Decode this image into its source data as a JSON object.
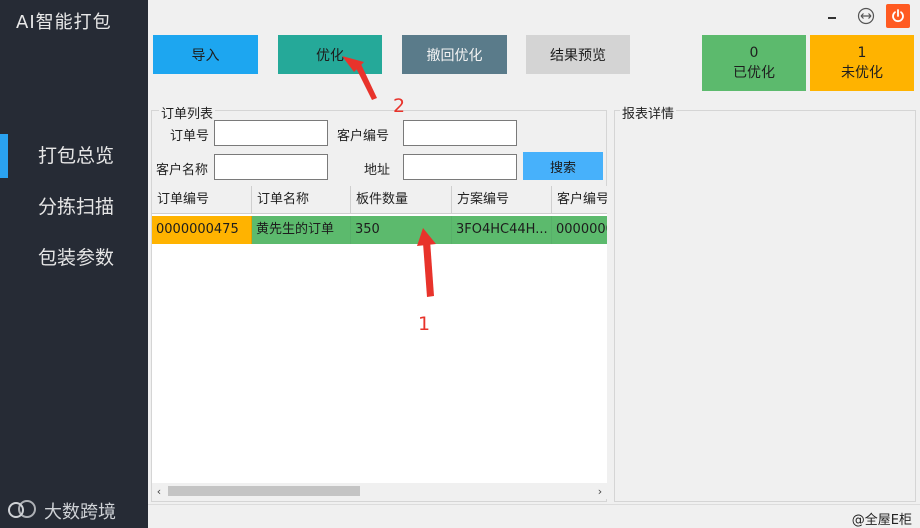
{
  "app": {
    "title": "AI智能打包"
  },
  "sidebar": {
    "items": [
      {
        "label": "打包总览",
        "active": true
      },
      {
        "label": "分拣扫描",
        "active": false
      },
      {
        "label": "包装参数",
        "active": false
      }
    ],
    "watermark": "大数跨境"
  },
  "window": {
    "minimize_icon": "minimize-icon",
    "restore_icon": "restore-icon",
    "power_icon": "power-icon",
    "power_color": "#ff5a21"
  },
  "toolbar": {
    "import_label": "导入",
    "optimize_label": "优化",
    "undo_label": "撤回优化",
    "preview_label": "结果预览"
  },
  "stats": {
    "optimized": {
      "count": "0",
      "label": "已优化",
      "color": "#5cba6d"
    },
    "not_optimized": {
      "count": "1",
      "label": "未优化",
      "color": "#ffb300"
    }
  },
  "orders": {
    "group_title": "订单列表",
    "form": {
      "order_no_label": "订单号",
      "customer_no_label": "客户编号",
      "customer_name_label": "客户名称",
      "address_label": "地址",
      "search_label": "搜索",
      "order_no_value": "",
      "customer_no_value": "",
      "customer_name_value": "",
      "address_value": ""
    },
    "table": {
      "columns": [
        "订单编号",
        "订单名称",
        "板件数量",
        "方案编号",
        "客户编号"
      ],
      "rows": [
        [
          "0000000475",
          "黄先生的订单",
          "350",
          "3FO4HC44H...",
          "0000000"
        ]
      ]
    }
  },
  "report": {
    "group_title": "报表详情"
  },
  "status": {
    "text": "@全屋E柜"
  },
  "annotations": {
    "label1": "1",
    "label2": "2",
    "color": "#e8332b"
  }
}
